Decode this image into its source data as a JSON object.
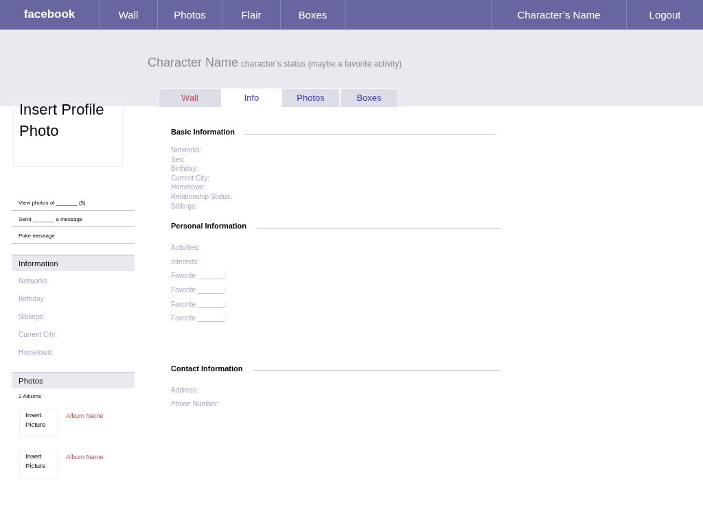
{
  "topbar": {
    "logo": "facebook",
    "links": [
      "Wall",
      "Photos",
      "Flair",
      "Boxes"
    ],
    "right_links": [
      "Character’s Name",
      "Logout"
    ]
  },
  "profile": {
    "name": "Character Name",
    "status": "character’s status (maybe a favorite activity)",
    "photo_placeholder": "Insert Profile Photo"
  },
  "tabs": [
    {
      "label": "Wall",
      "selected": false,
      "color": "#c0504d"
    },
    {
      "label": "Info",
      "selected": true,
      "color": "#3b3bb3"
    },
    {
      "label": "Photos",
      "selected": false,
      "color": "#3b3bb3"
    },
    {
      "label": "Boxes",
      "selected": false,
      "color": "#3b3bb3"
    }
  ],
  "sidebar": {
    "actions": [
      "View photos of _______ (5)",
      "Send _______ a message",
      "Poke message"
    ],
    "information": {
      "title": "Information",
      "items": [
        "Networks",
        "Birthday:",
        "Siblings:",
        "Current City:",
        "Hometown:"
      ]
    },
    "photos": {
      "title": "Photos",
      "count": "2 Albums",
      "albums": [
        {
          "picture": "Insert Picture",
          "name": "Album Name"
        },
        {
          "picture": "Insert Picture",
          "name": "Album Name"
        }
      ]
    }
  },
  "sections": [
    {
      "title": "Basic Information",
      "kind": "compact",
      "fields": [
        "Networks:",
        "Sex:",
        "Birthday:",
        "Current City:",
        "Hometown:",
        "Relationship Status:",
        "Siblings:"
      ]
    },
    {
      "title": "Personal Information",
      "kind": "spaced",
      "fields": [
        "Activities:",
        "Interests:",
        "Favorite _______:",
        "Favorite _______:",
        "Favorite _______:",
        "Favorite _______:"
      ]
    },
    {
      "title": "Contact Information",
      "kind": "spaced",
      "fields": [
        "Address:",
        "Phone Number:"
      ]
    }
  ]
}
